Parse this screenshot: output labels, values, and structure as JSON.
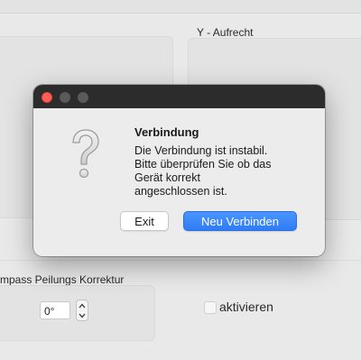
{
  "background": {
    "y_panel_title": "Y - Aufrecht",
    "compass_label": "mpass Peilungs Korrektur",
    "compass_value": "0°",
    "activate_label": "aktivieren"
  },
  "dialog": {
    "title": "Verbindung",
    "message": "Die Verbindung ist instabil.\nBitte überprüfen Sie ob das\nGerät korrekt\nangeschlossen ist.",
    "buttons": {
      "exit": "Exit",
      "reconnect": "Neu Verbinden"
    },
    "icon": "question-mark-icon"
  },
  "colors": {
    "primary_button": "#2f7cf6",
    "titlebar": "#2c2c2c",
    "close_light": "#ff5f57"
  }
}
